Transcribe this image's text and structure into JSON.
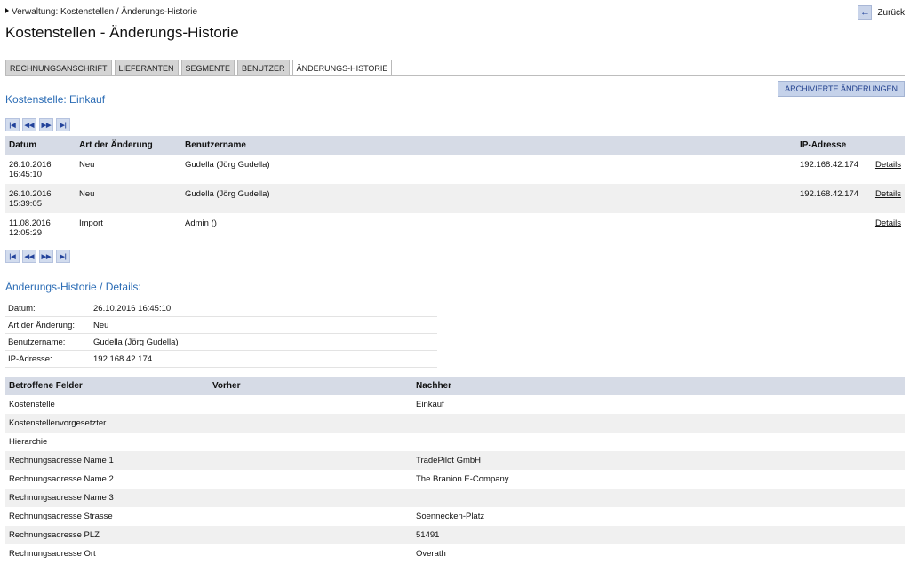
{
  "breadcrumb": "Verwaltung: Kostenstellen / Änderungs-Historie",
  "back_label": "Zurück",
  "page_title": "Kostenstellen - Änderungs-Historie",
  "tabs": [
    {
      "label": "RECHNUNGSANSCHRIFT",
      "active": false
    },
    {
      "label": "LIEFERANTEN",
      "active": false
    },
    {
      "label": "SEGMENTE",
      "active": false
    },
    {
      "label": "BENUTZER",
      "active": false
    },
    {
      "label": "ÄNDERUNGS-HISTORIE",
      "active": true
    }
  ],
  "cost_center_title": "Kostenstelle: Einkauf",
  "archive_button": "ARCHIVIERTE ÄNDERUNGEN",
  "pager_icons": [
    "first-page-icon",
    "previous-page-icon",
    "next-page-icon",
    "last-page-icon"
  ],
  "history": {
    "headers": {
      "date": "Datum",
      "type": "Art der Änderung",
      "user": "Benutzername",
      "ip": "IP-Adresse"
    },
    "rows": [
      {
        "date": "26.10.2016",
        "time": "16:45:10",
        "type": "Neu",
        "user": "Gudella (Jörg Gudella)",
        "ip": "192.168.42.174",
        "details": "Details"
      },
      {
        "date": "26.10.2016",
        "time": "15:39:05",
        "type": "Neu",
        "user": "Gudella (Jörg Gudella)",
        "ip": "192.168.42.174",
        "details": "Details"
      },
      {
        "date": "11.08.2016",
        "time": "12:05:29",
        "type": "Import",
        "user": "Admin ()",
        "ip": "",
        "details": "Details"
      }
    ]
  },
  "details_title": "Änderungs-Historie / Details:",
  "details_info": [
    {
      "label": "Datum:",
      "value": "26.10.2016 16:45:10"
    },
    {
      "label": "Art der Änderung:",
      "value": "Neu"
    },
    {
      "label": "Benutzername:",
      "value": "Gudella (Jörg Gudella)"
    },
    {
      "label": "IP-Adresse:",
      "value": "192.168.42.174"
    }
  ],
  "fields_table": {
    "headers": {
      "field": "Betroffene Felder",
      "before": "Vorher",
      "after": "Nachher"
    },
    "rows": [
      {
        "field": "Kostenstelle",
        "before": "",
        "after": "Einkauf"
      },
      {
        "field": "Kostenstellenvorgesetzter",
        "before": "",
        "after": ""
      },
      {
        "field": "Hierarchie",
        "before": "",
        "after": ""
      },
      {
        "field": "Rechnungsadresse Name 1",
        "before": "",
        "after": "TradePilot GmbH"
      },
      {
        "field": "Rechnungsadresse Name 2",
        "before": "",
        "after": "The Branion E-Company"
      },
      {
        "field": "Rechnungsadresse Name 3",
        "before": "",
        "after": ""
      },
      {
        "field": "Rechnungsadresse Strasse",
        "before": "",
        "after": "Soennecken-Platz"
      },
      {
        "field": "Rechnungsadresse PLZ",
        "before": "",
        "after": "51491"
      },
      {
        "field": "Rechnungsadresse Ort",
        "before": "",
        "after": "Overath"
      }
    ]
  },
  "colors": {
    "accent": "#2b6cb5",
    "header_bg": "#d6dbe6",
    "alt_row": "#f0f0f0",
    "button_bg": "#c5d2ea"
  }
}
